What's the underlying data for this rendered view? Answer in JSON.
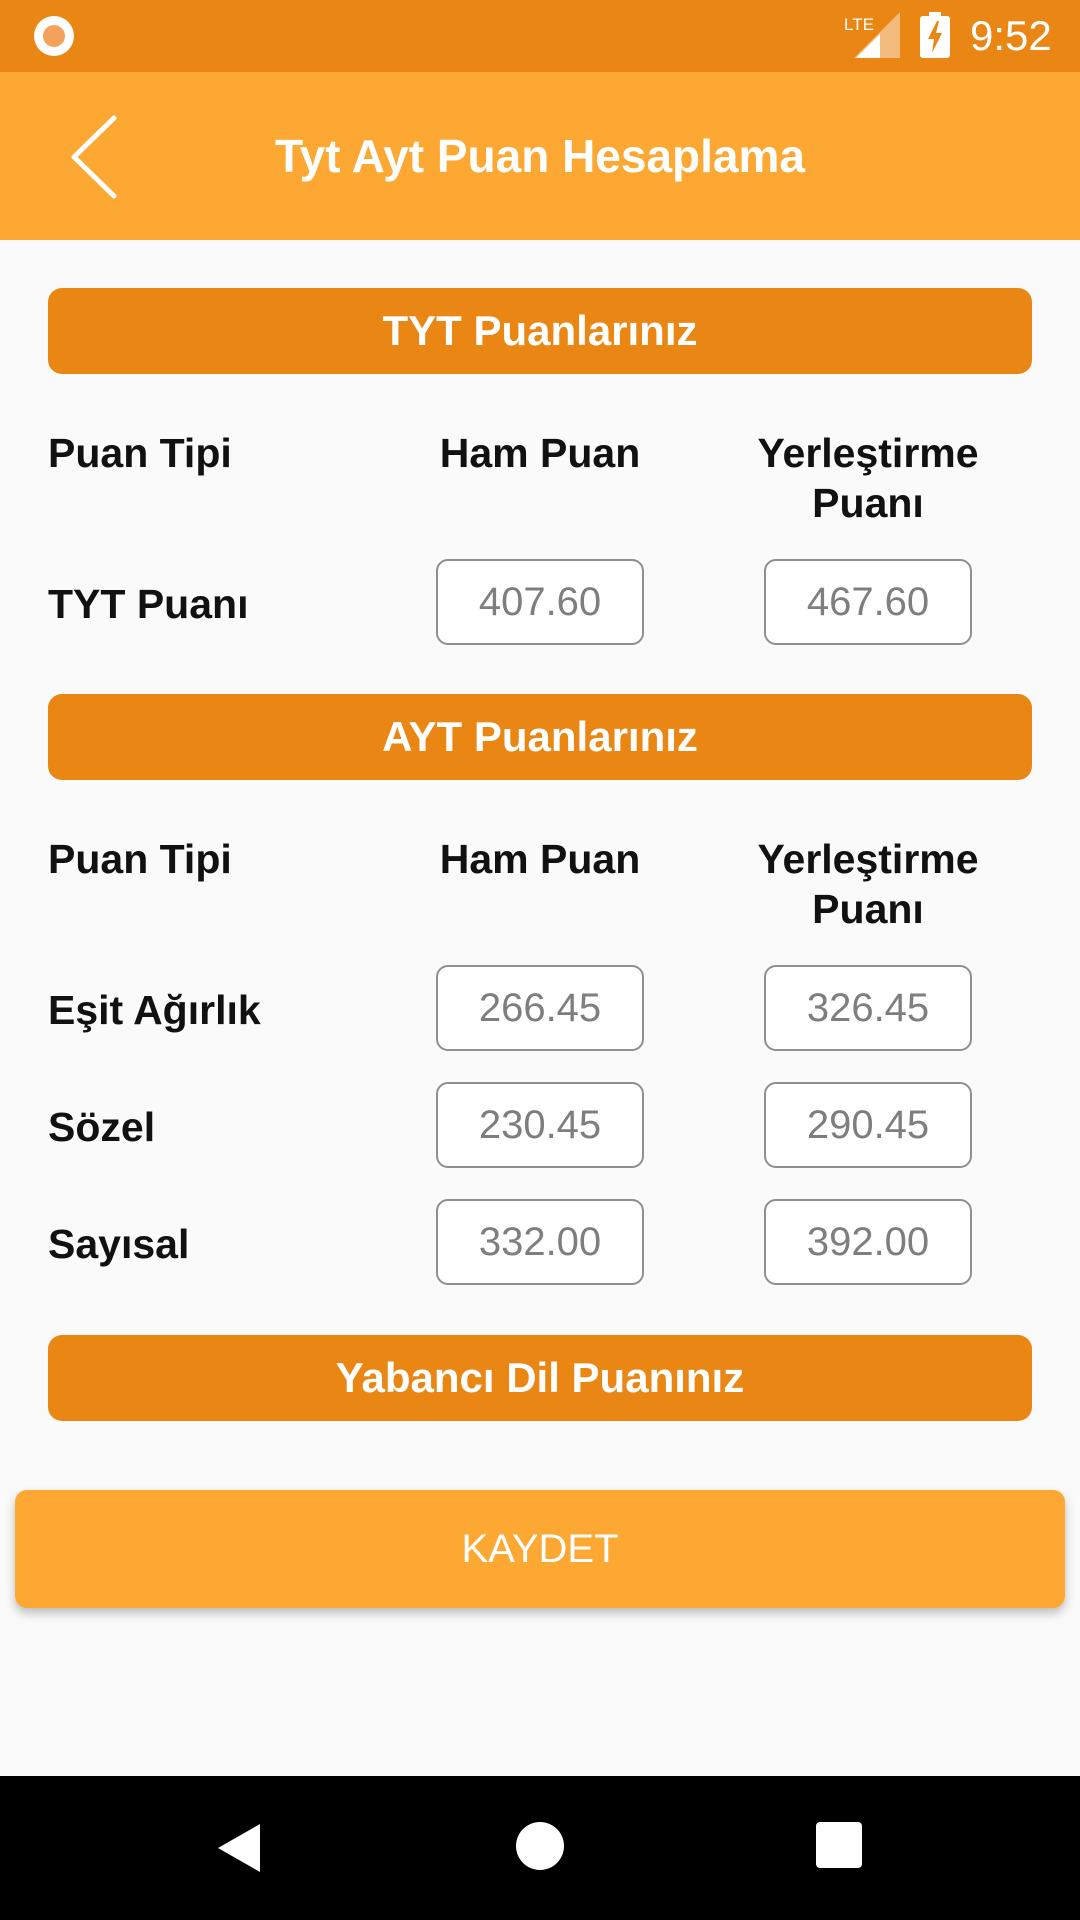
{
  "status_bar": {
    "time": "9:52",
    "network_text": "LTE",
    "icons": [
      "notification-icon",
      "lte-signal-icon",
      "battery-charging-icon"
    ]
  },
  "app_bar": {
    "title": "Tyt Ayt Puan Hesaplama",
    "back_icon": "chevron-left-icon"
  },
  "tyt_section": {
    "header": "TYT Puanlarınız",
    "columns": {
      "type": "Puan Tipi",
      "raw": "Ham Puan",
      "placement_1": "Yerleştirme",
      "placement_2": "Puanı"
    },
    "rows": [
      {
        "label": "TYT Puanı",
        "raw": "407.60",
        "placement": "467.60"
      }
    ]
  },
  "ayt_section": {
    "header": "AYT Puanlarınız",
    "columns": {
      "type": "Puan Tipi",
      "raw": "Ham Puan",
      "placement_1": "Yerleştirme",
      "placement_2": "Puanı"
    },
    "rows": [
      {
        "label": "Eşit Ağırlık",
        "raw": "266.45",
        "placement": "326.45"
      },
      {
        "label": "Sözel",
        "raw": "230.45",
        "placement": "290.45"
      },
      {
        "label": "Sayısal",
        "raw": "332.00",
        "placement": "392.00"
      }
    ]
  },
  "foreign_language_section": {
    "header": "Yabancı Dil Puanınız"
  },
  "save_button": {
    "label": "KAYDET"
  },
  "nav_bar": {
    "icons": [
      "back-triangle-icon",
      "home-circle-icon",
      "recents-square-icon"
    ]
  },
  "colors": {
    "status_bar": "#ea8614",
    "app_bar": "#fea834",
    "section_header": "#ea8614",
    "save_button": "#fea834",
    "background": "#fafafa"
  }
}
